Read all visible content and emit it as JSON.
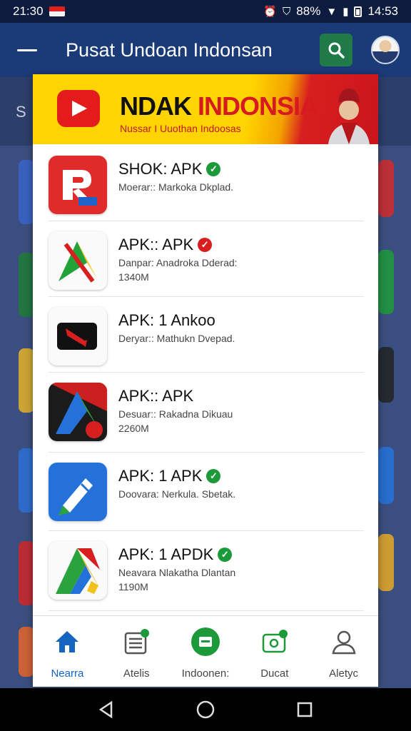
{
  "status_bar": {
    "left_time": "21:30",
    "battery": "88%",
    "time": "14:53"
  },
  "app_bar": {
    "title": "Pusat Undoan Indonsan"
  },
  "background": {
    "partial_text": "S"
  },
  "banner": {
    "title_part1": "NDAK ",
    "title_part2": "INDONSIA",
    "subtitle": "Nussar I Uuothan Indoosas"
  },
  "apps": [
    {
      "name": "SHOK: APK",
      "desc": "Moerar:: Markoka Dkplad.",
      "size": "",
      "badge": "green",
      "icon": "red-r-app-icon"
    },
    {
      "name": "APK:: APK",
      "desc": "Danpar: Anadroka Dderad:",
      "size": "1340M",
      "badge": "red",
      "icon": "green-triangle-app-icon"
    },
    {
      "name": "APK: 1 Ankoo",
      "desc": "Deryar:: Mathukn Dvepad.",
      "size": "",
      "badge": "",
      "icon": "black-arrow-app-icon"
    },
    {
      "name": "APK:: APK",
      "desc": "Desuar:: Rakadna Dikuau",
      "size": "2260M",
      "badge": "",
      "icon": "dark-a-app-icon"
    },
    {
      "name": "APK: 1 APK",
      "desc": "Doovara: Nerkula. Sbetak.",
      "size": "",
      "badge": "green",
      "icon": "blue-pen-app-icon"
    },
    {
      "name": "APK: 1 APDK",
      "desc": "Neavara Nlakatha Dlantan",
      "size": "1190M",
      "badge": "green",
      "icon": "google-a-app-icon"
    }
  ],
  "bottom_nav": [
    {
      "label": "Nearra",
      "icon": "home-icon",
      "active": true
    },
    {
      "label": "Atelis",
      "icon": "news-icon",
      "active": false
    },
    {
      "label": "Indoonen:",
      "icon": "green-circle-icon",
      "active": false
    },
    {
      "label": "Ducat",
      "icon": "wallet-icon",
      "active": false
    },
    {
      "label": "Aletyc",
      "icon": "profile-icon",
      "active": false
    }
  ],
  "colors": {
    "app_bar": "#1b3a78",
    "accent": "#1565c0",
    "verified": "#1c9a3a",
    "alert": "#d81f1f"
  }
}
